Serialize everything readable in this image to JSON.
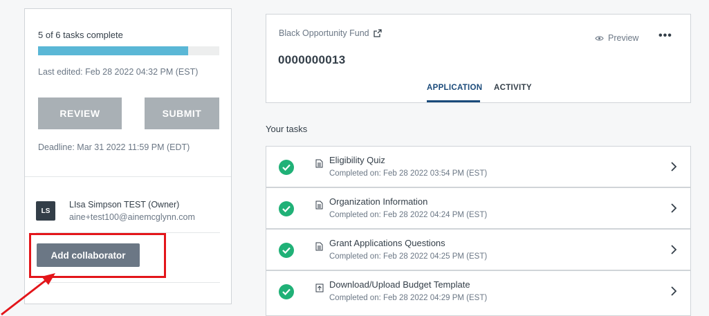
{
  "progress": {
    "text": "5 of 6 tasks complete",
    "fraction": 0.83,
    "last_edited": "Last edited: Feb 28 2022 04:32 PM (EST)"
  },
  "buttons": {
    "review": "REVIEW",
    "submit": "SUBMIT",
    "add_collaborator": "Add collaborator"
  },
  "deadline": "Deadline: Mar 31 2022 11:59 PM (EDT)",
  "owner": {
    "initials": "LS",
    "name": "LIsa Simpson TEST (Owner)",
    "email": "aine+test100@ainemcglynn.com"
  },
  "header": {
    "fund_name": "Black Opportunity Fund",
    "preview": "Preview",
    "app_number": "0000000013",
    "tabs": [
      "APPLICATION",
      "ACTIVITY"
    ]
  },
  "tasks_heading": "Your tasks",
  "tasks": [
    {
      "title": "Eligibility Quiz",
      "completed": "Completed on: Feb 28 2022 03:54 PM (EST)",
      "icon": "document-icon"
    },
    {
      "title": "Organization Information",
      "completed": "Completed on: Feb 28 2022 04:24 PM (EST)",
      "icon": "document-icon"
    },
    {
      "title": "Grant Applications Questions",
      "completed": "Completed on: Feb 28 2022 04:25 PM (EST)",
      "icon": "document-icon"
    },
    {
      "title": "Download/Upload Budget Template",
      "completed": "Completed on: Feb 28 2022 04:29 PM (EST)",
      "icon": "upload-icon"
    }
  ],
  "colors": {
    "progress": "#5ab7d6",
    "check": "#20b177",
    "highlight": "#e3151a",
    "active_tab": "#1a4a7a"
  }
}
